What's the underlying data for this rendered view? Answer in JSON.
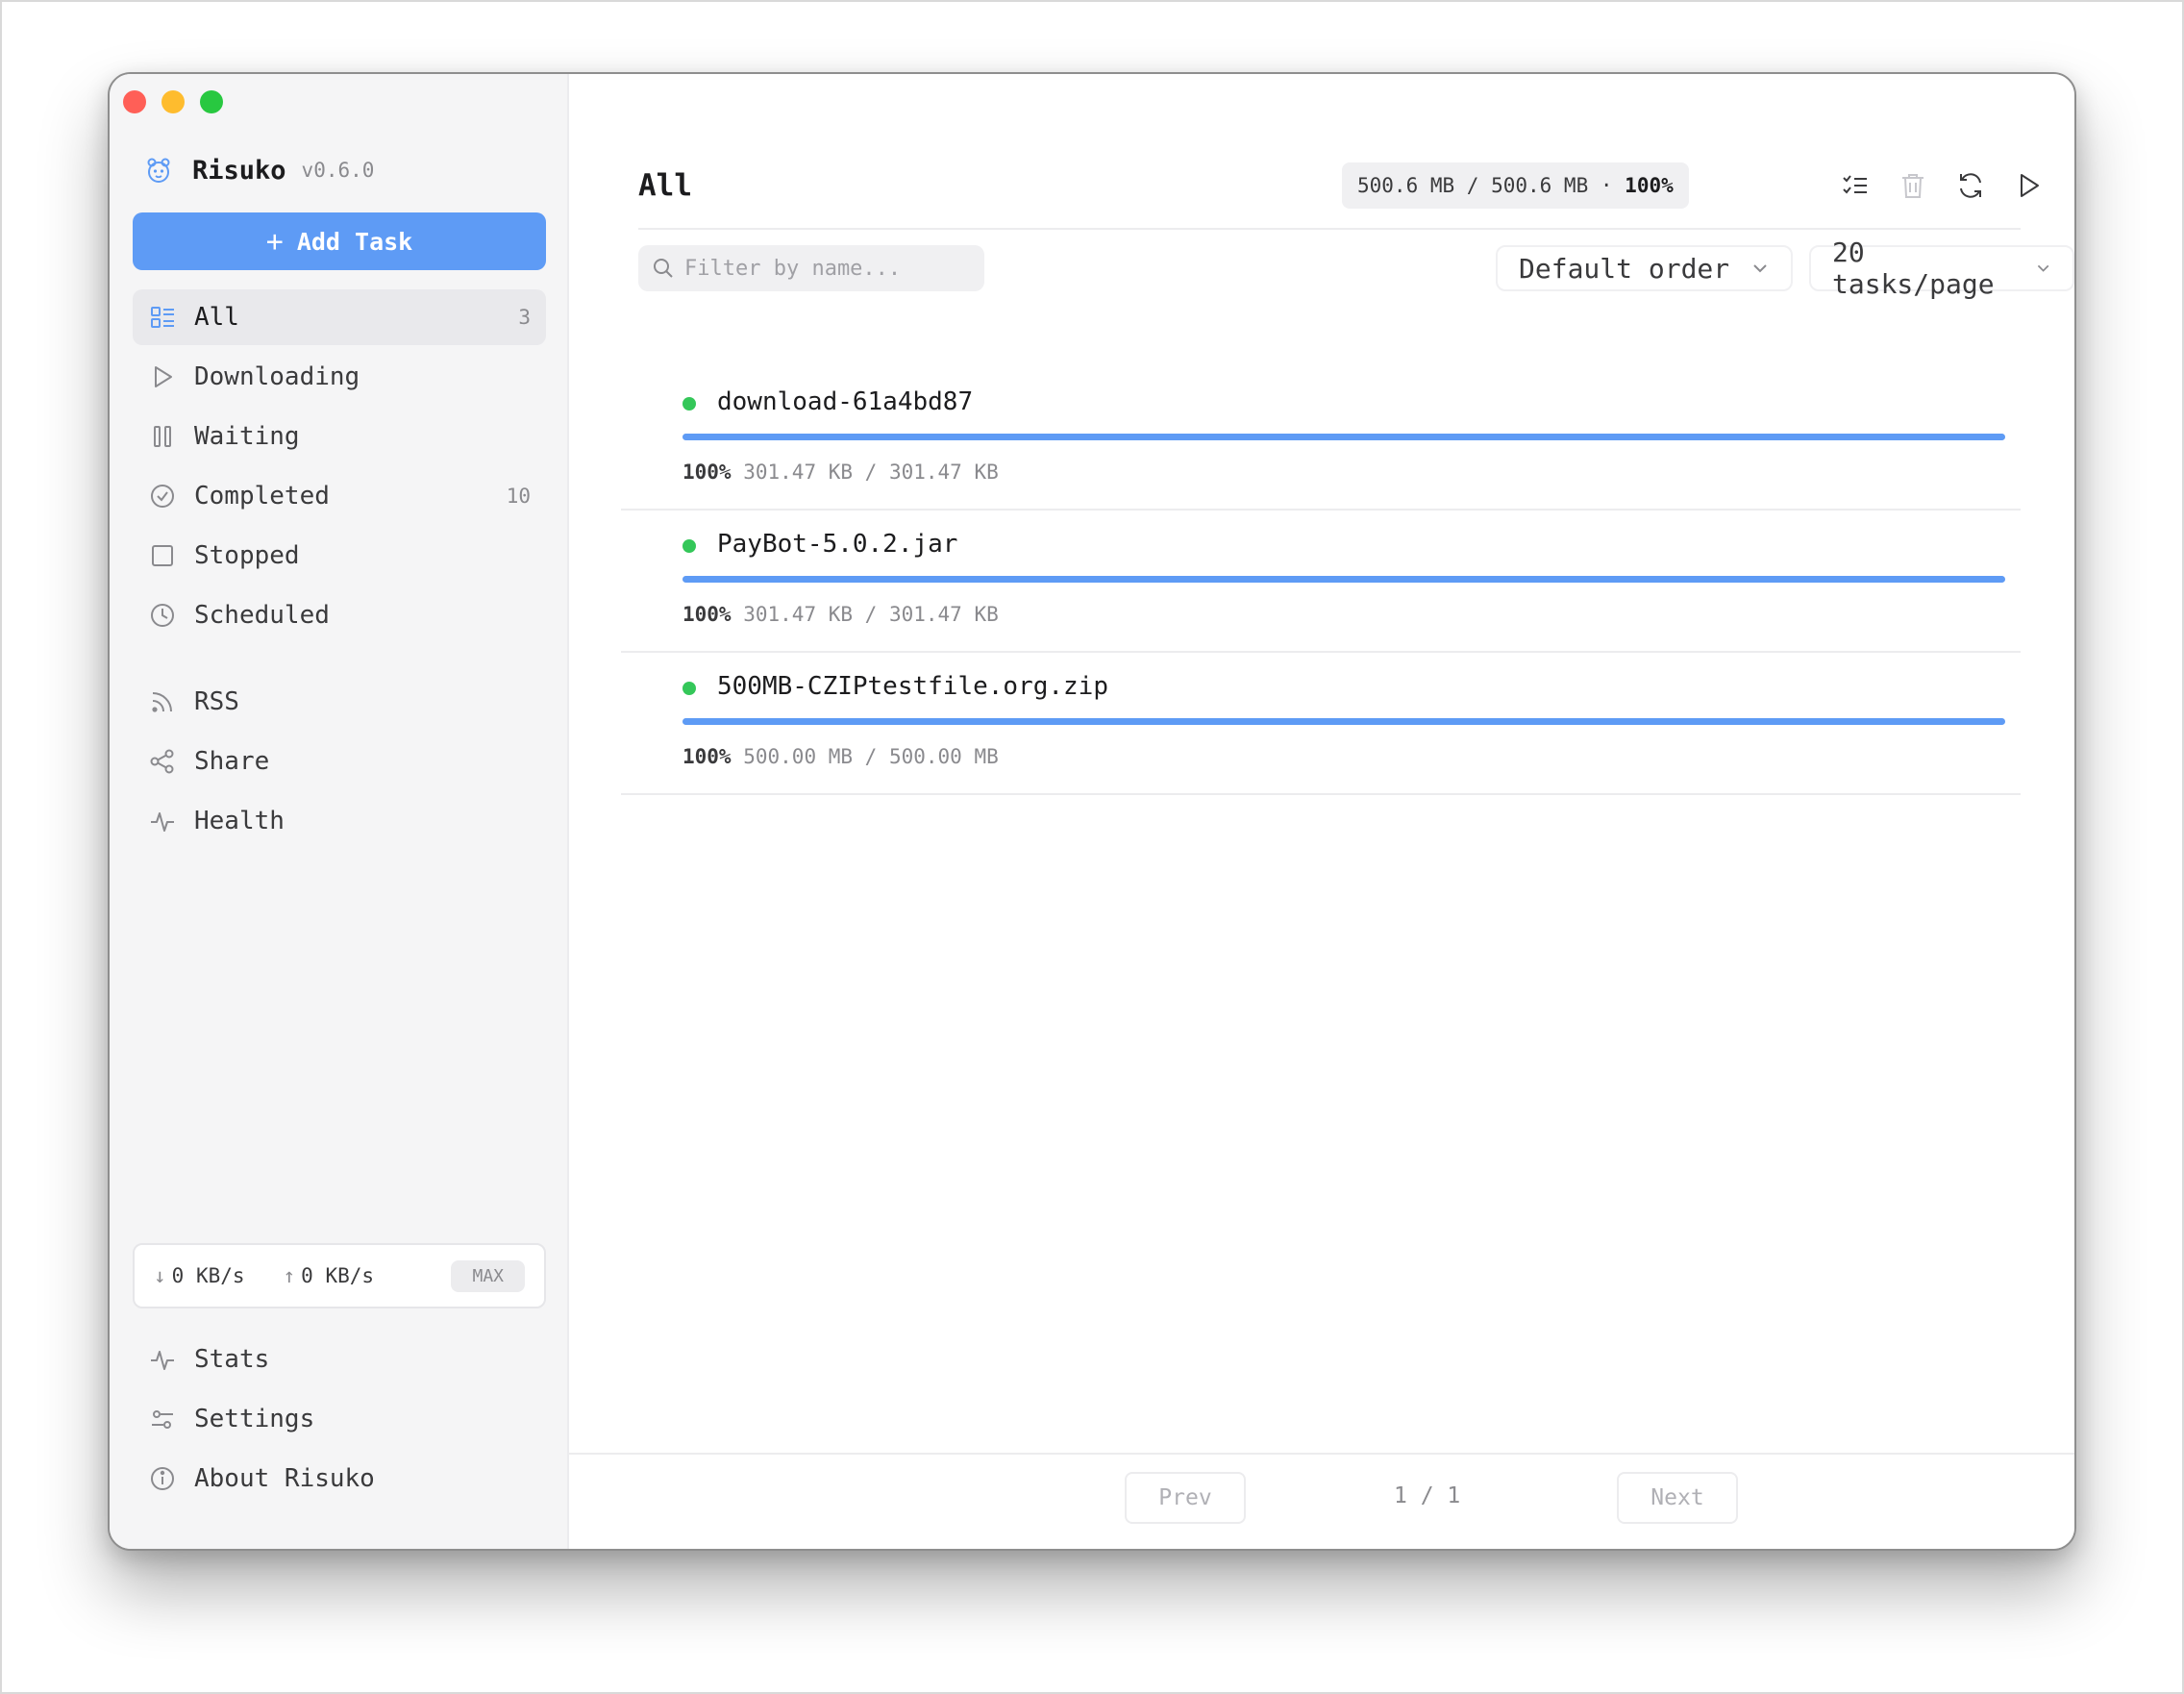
{
  "app": {
    "name": "Risuko",
    "version": "v0.6.0"
  },
  "sidebar": {
    "add_task_label": "Add Task",
    "nav": [
      {
        "key": "all",
        "label": "All",
        "count": "3",
        "icon": "list-icon"
      },
      {
        "key": "downloading",
        "label": "Downloading",
        "count": "",
        "icon": "play-icon"
      },
      {
        "key": "waiting",
        "label": "Waiting",
        "count": "",
        "icon": "pause-icon"
      },
      {
        "key": "completed",
        "label": "Completed",
        "count": "10",
        "icon": "check-circle-icon"
      },
      {
        "key": "stopped",
        "label": "Stopped",
        "count": "",
        "icon": "square-icon"
      },
      {
        "key": "scheduled",
        "label": "Scheduled",
        "count": "",
        "icon": "clock-icon"
      }
    ],
    "extras": [
      {
        "key": "rss",
        "label": "RSS",
        "icon": "rss-icon"
      },
      {
        "key": "share",
        "label": "Share",
        "icon": "share-icon"
      },
      {
        "key": "health",
        "label": "Health",
        "icon": "activity-icon"
      }
    ],
    "speed": {
      "down": "0 KB/s",
      "up": "0 KB/s",
      "limit": "MAX"
    },
    "bottom": [
      {
        "key": "stats",
        "label": "Stats",
        "icon": "activity-icon"
      },
      {
        "key": "settings",
        "label": "Settings",
        "icon": "sliders-icon"
      },
      {
        "key": "about",
        "label": "About Risuko",
        "icon": "info-icon"
      }
    ]
  },
  "main": {
    "title": "All",
    "summary": {
      "sizes": "500.6 MB / 500.6 MB ·",
      "percent": "100%"
    },
    "filter_placeholder": "Filter by name...",
    "order_select": "Default order",
    "page_size_select": "20 tasks/page",
    "tasks": [
      {
        "name": "download-61a4bd87",
        "percent": "100%",
        "progress": 1.0,
        "size": "301.47 KB / 301.47 KB"
      },
      {
        "name": "PayBot-5.0.2.jar",
        "percent": "100%",
        "progress": 1.0,
        "size": "301.47 KB / 301.47 KB"
      },
      {
        "name": "500MB-CZIPtestfile.org.zip",
        "percent": "100%",
        "progress": 1.0,
        "size": "500.00 MB / 500.00 MB"
      }
    ],
    "pagination": {
      "prev": "Prev",
      "page": "1 / 1",
      "next": "Next"
    }
  },
  "colors": {
    "accent": "#5e9bf5",
    "status_dot": "#34c759",
    "sidebar_bg": "#f5f5f6"
  }
}
